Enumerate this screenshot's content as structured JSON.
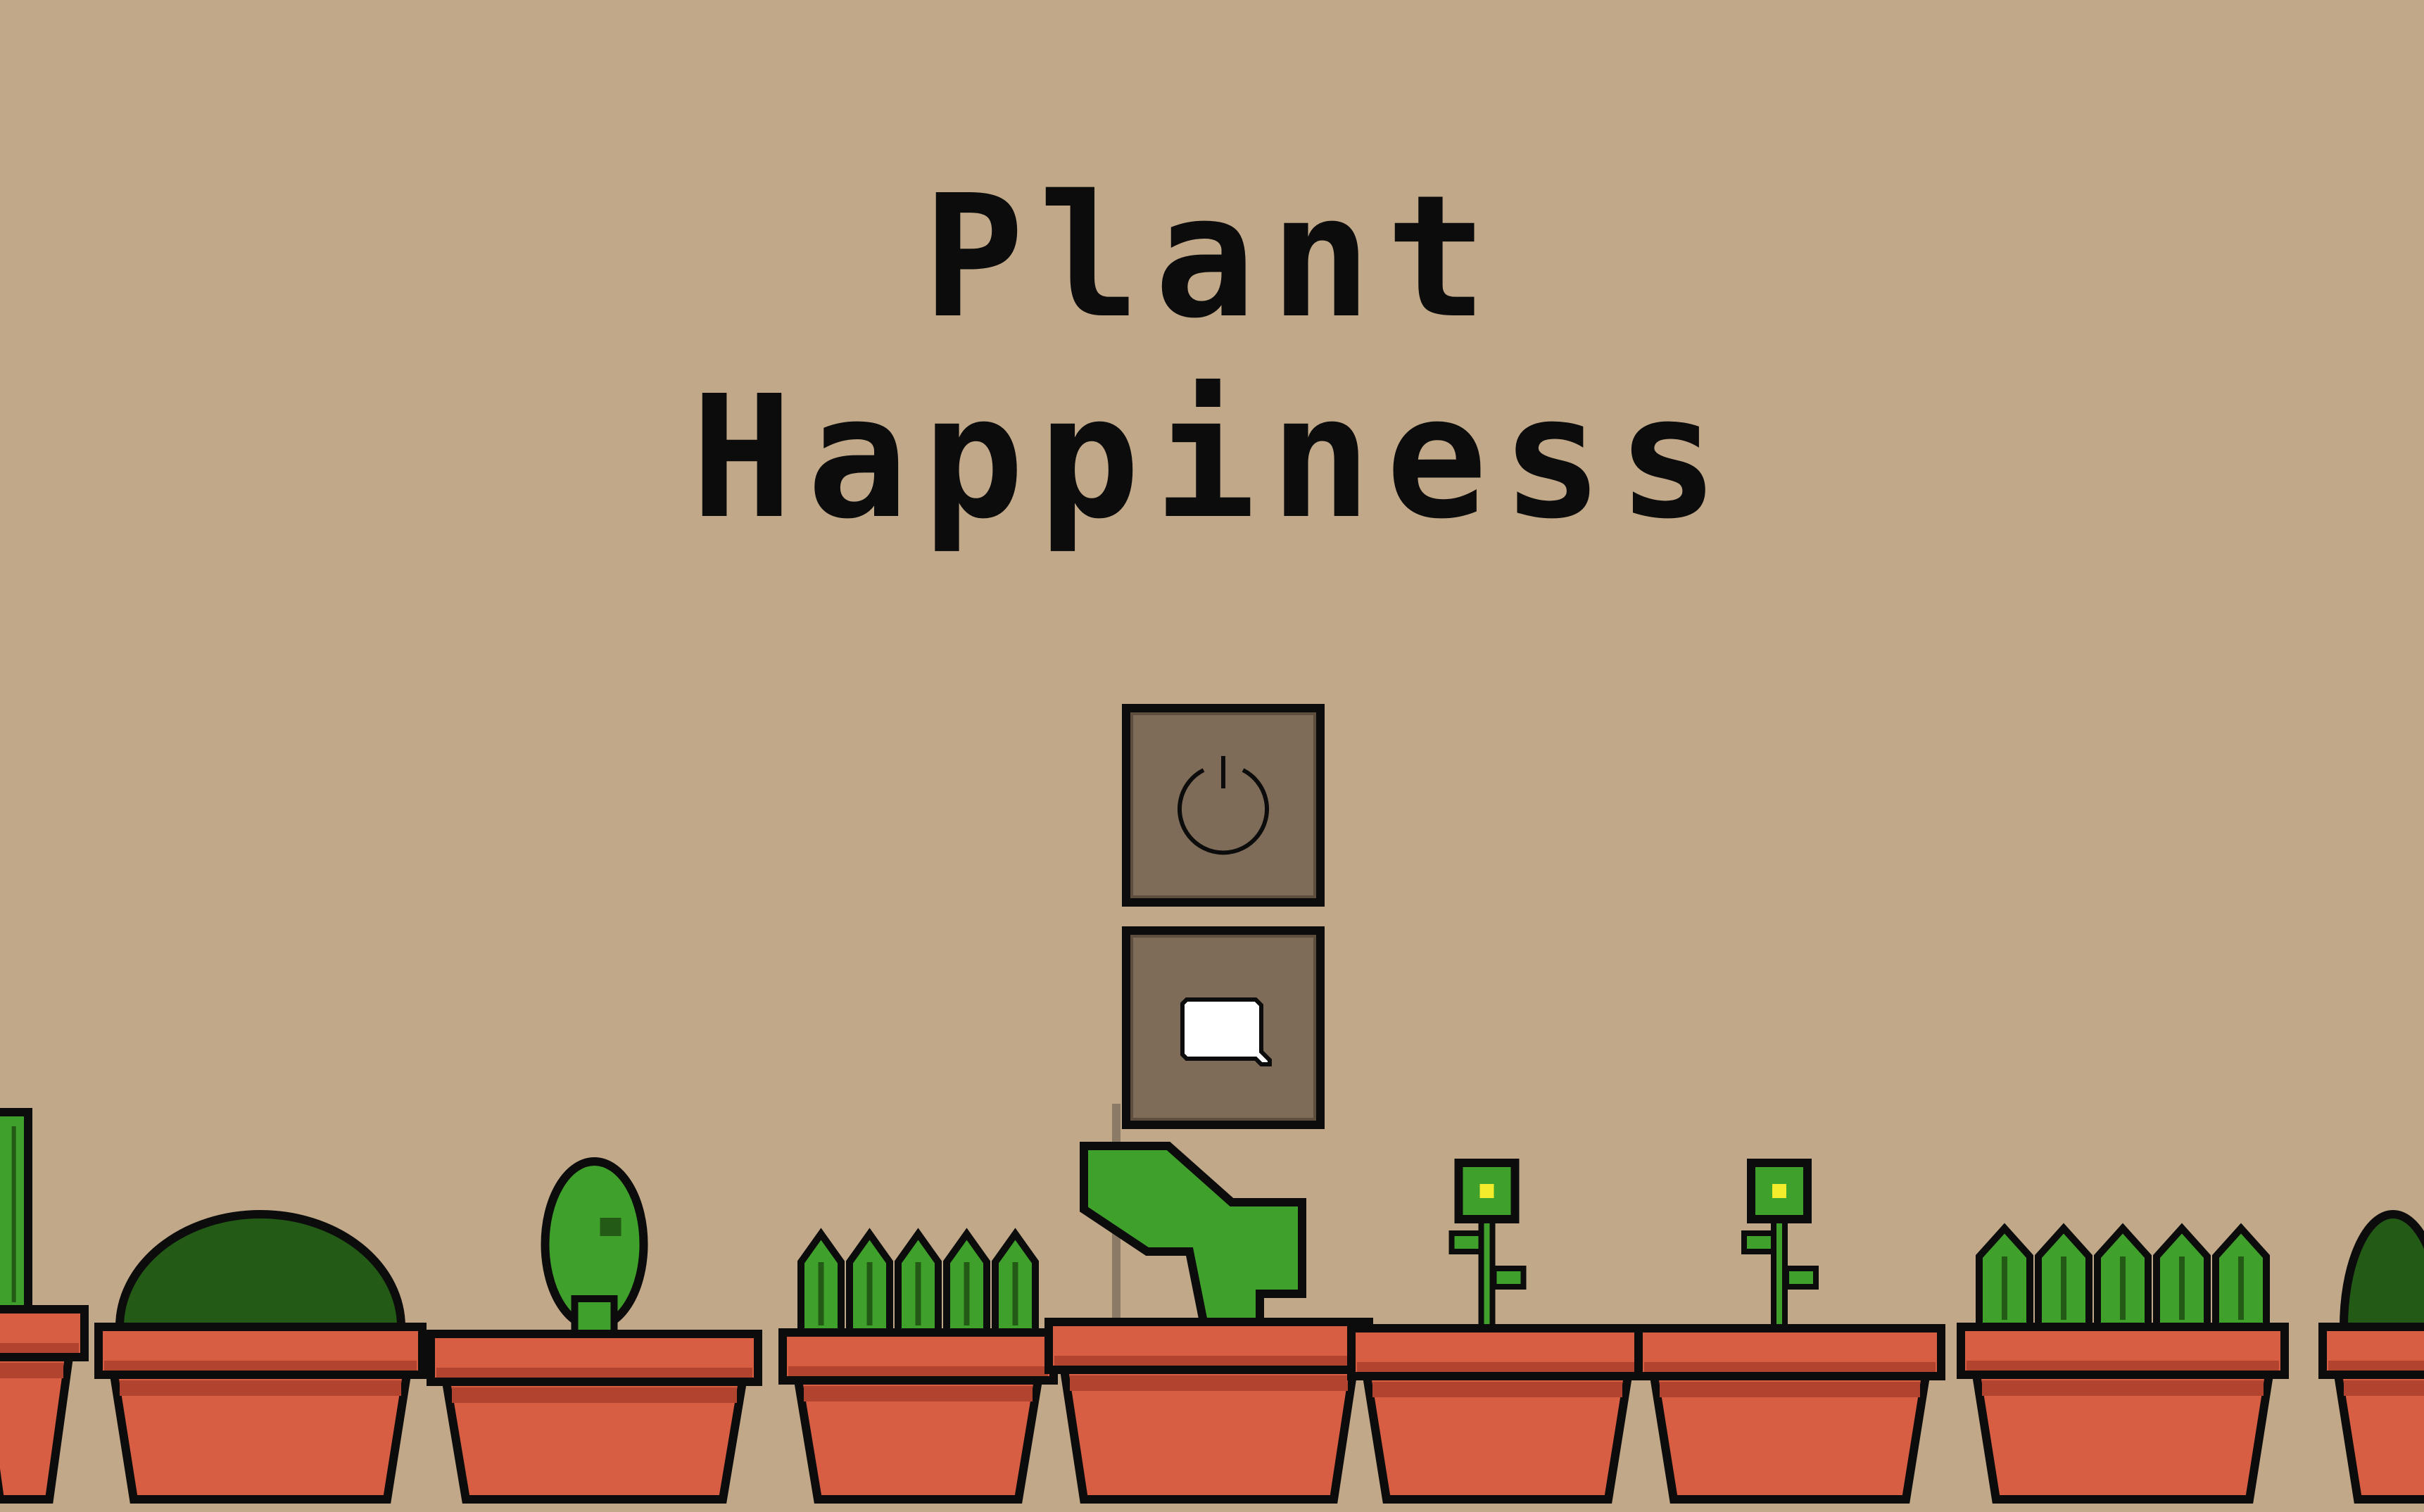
{
  "game": {
    "title_line_1": "Plant",
    "title_line_2": "Happiness"
  },
  "menu": {
    "buttons": [
      {
        "id": "power",
        "icon": "power-icon"
      },
      {
        "id": "chat",
        "icon": "speech-bubble-icon"
      }
    ]
  },
  "garden": {
    "plants": [
      "cactus",
      "round-bush",
      "oval-cactus",
      "grass-tufts",
      "leafy-sprout",
      "flower-sprout",
      "flower-sprout",
      "grass-tufts",
      "round-bush"
    ]
  },
  "colors": {
    "background": "#c0a888",
    "outline": "#0c0c0c",
    "button_fill": "#7e6c58",
    "pot_main": "#d75d43",
    "pot_shadow": "#b2432f",
    "leaf_green": "#3fa12b",
    "leaf_dark": "#235a16",
    "flower_yellow": "#f2ec2c"
  }
}
